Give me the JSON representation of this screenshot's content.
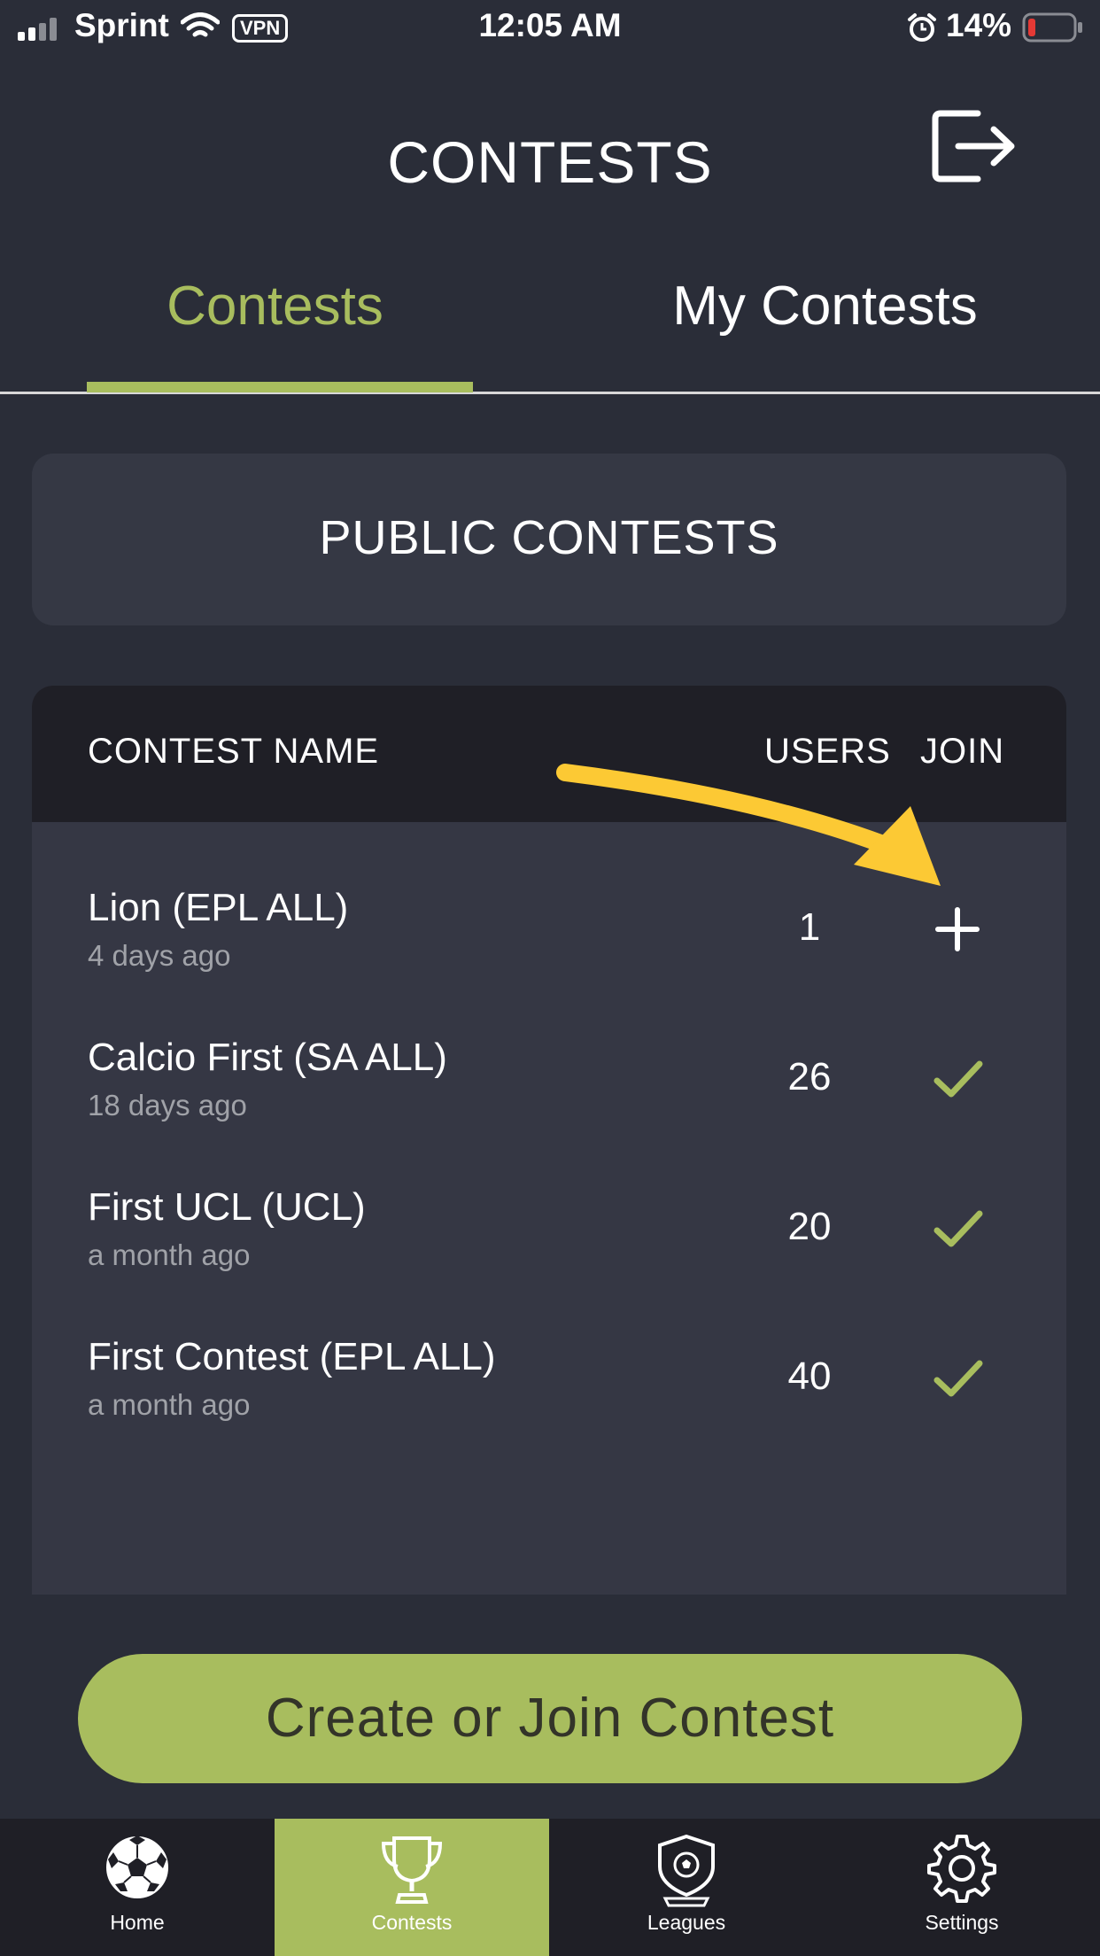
{
  "status_bar": {
    "carrier": "Sprint",
    "vpn": "VPN",
    "time": "12:05 AM",
    "battery": "14%"
  },
  "header": {
    "title": "CONTESTS",
    "logout_icon": "logout-icon"
  },
  "tabs": [
    {
      "label": "Contests",
      "active": true
    },
    {
      "label": "My Contests",
      "active": false
    }
  ],
  "public_card": {
    "title": "PUBLIC CONTESTS"
  },
  "table": {
    "columns": {
      "name": "CONTEST NAME",
      "users": "USERS",
      "join": "JOIN"
    },
    "rows": [
      {
        "name": "Lion (EPL ALL)",
        "time": "4 days ago",
        "users": "1",
        "join_state": "plus-icon"
      },
      {
        "name": "Calcio First (SA ALL)",
        "time": "18 days ago",
        "users": "26",
        "join_state": "check-icon"
      },
      {
        "name": "First UCL (UCL)",
        "time": "a month ago",
        "users": "20",
        "join_state": "check-icon"
      },
      {
        "name": "First Contest (EPL ALL)",
        "time": "a month ago",
        "users": "40",
        "join_state": "check-icon"
      }
    ]
  },
  "cta": {
    "label": "Create or Join Contest"
  },
  "bottom_nav": [
    {
      "label": "Home",
      "icon": "soccer-ball-icon",
      "active": false
    },
    {
      "label": "Contests",
      "icon": "trophy-icon",
      "active": true
    },
    {
      "label": "Leagues",
      "icon": "shield-icon",
      "active": false
    },
    {
      "label": "Settings",
      "icon": "gear-icon",
      "active": false
    }
  ],
  "colors": {
    "background": "#2a2d38",
    "accent": "#a8bd5e",
    "annotation_arrow": "#fcc934"
  }
}
